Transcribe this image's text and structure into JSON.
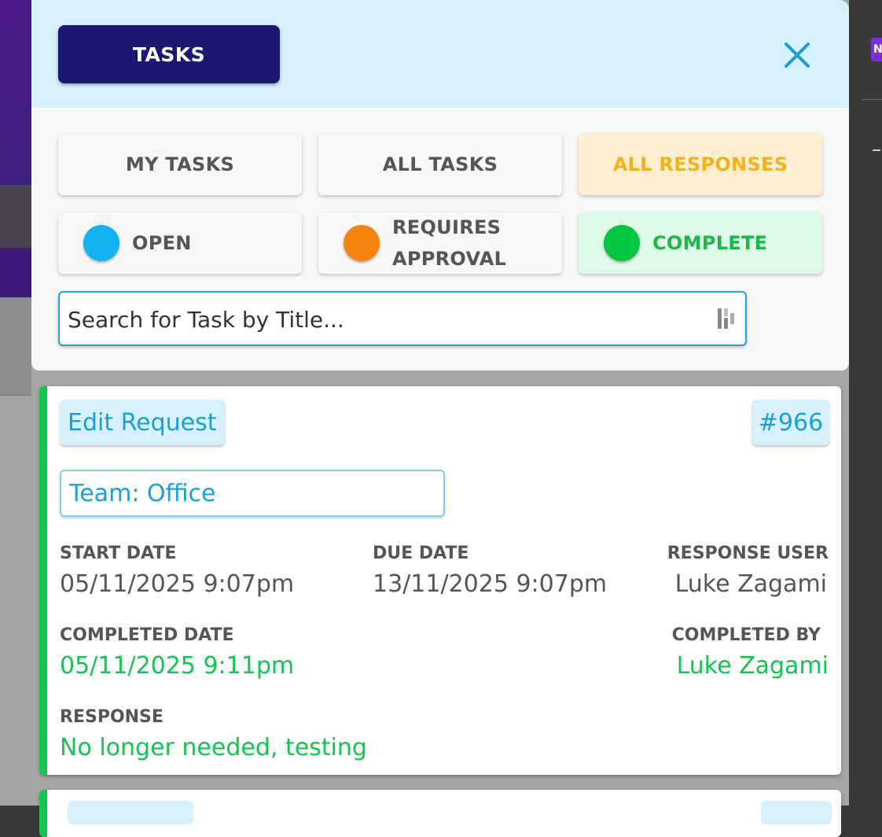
{
  "header": {
    "title": "TASKS",
    "close_icon": "close-icon"
  },
  "filters": {
    "my_tasks": "MY TASKS",
    "all_tasks": "ALL TASKS",
    "all_responses": "ALL RESPONSES",
    "status": [
      {
        "label": "OPEN",
        "color": "#12b2f2"
      },
      {
        "label_line1": "REQUIRES",
        "label_line2": "APPROVAL",
        "color": "#f4840f"
      },
      {
        "label": "COMPLETE",
        "color": "#05c642"
      }
    ]
  },
  "search": {
    "placeholder": "Search for Task by Title...",
    "icon": "keyboard-icon"
  },
  "task_card": {
    "title": "Edit Request",
    "number": "#966",
    "team": "Team: Office",
    "start_date_label": "START DATE",
    "start_date": "05/11/2025 9:07pm",
    "due_date_label": "DUE DATE",
    "due_date": "13/11/2025 9:07pm",
    "response_user_label": "RESPONSE USER",
    "response_user": "Luke Zagami",
    "completed_date_label": "COMPLETED DATE",
    "completed_date": "05/11/2025 9:11pm",
    "completed_by_label": "COMPLETED BY",
    "completed_by": "Luke Zagami",
    "response_label": "RESPONSE",
    "response": "No longer needed, testing",
    "status_color": "#13c44f"
  },
  "colors": {
    "accent": "#1a9fd8",
    "header_bg": "#d6f1fc",
    "title_button": "#1a1870",
    "responses_text": "#f3b21c",
    "complete_green": "#13c44f"
  }
}
